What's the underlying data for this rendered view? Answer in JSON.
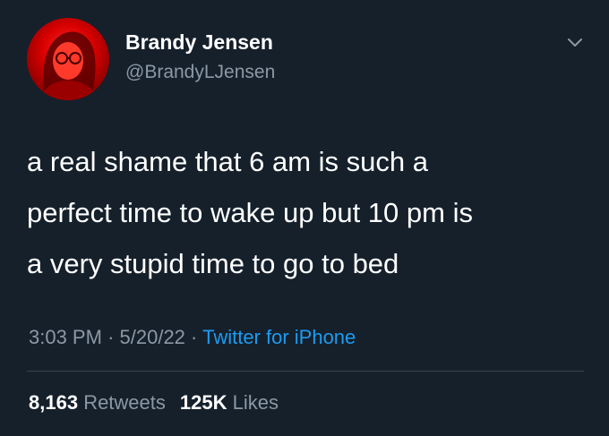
{
  "author": {
    "name": "Brandy Jensen",
    "handle": "@BrandyLJensen"
  },
  "tweet": {
    "lines": [
      "a real shame that 6 am is such a",
      "perfect time to wake up but 10 pm is",
      "a very stupid time to go to bed"
    ]
  },
  "meta": {
    "time": "3:03 PM",
    "separator": "·",
    "date": "5/20/22",
    "source": "Twitter for iPhone"
  },
  "stats": {
    "retweets_count": "8,163",
    "retweets_label": "Retweets",
    "likes_count": "125K",
    "likes_label": "Likes"
  },
  "colors": {
    "background": "#15202b",
    "primary_text": "#ffffff",
    "secondary_text": "#8b98a5",
    "link": "#1d9bf0",
    "avatar_tint": "#d80000"
  },
  "icons": {
    "menu": "chevron-down-icon"
  }
}
